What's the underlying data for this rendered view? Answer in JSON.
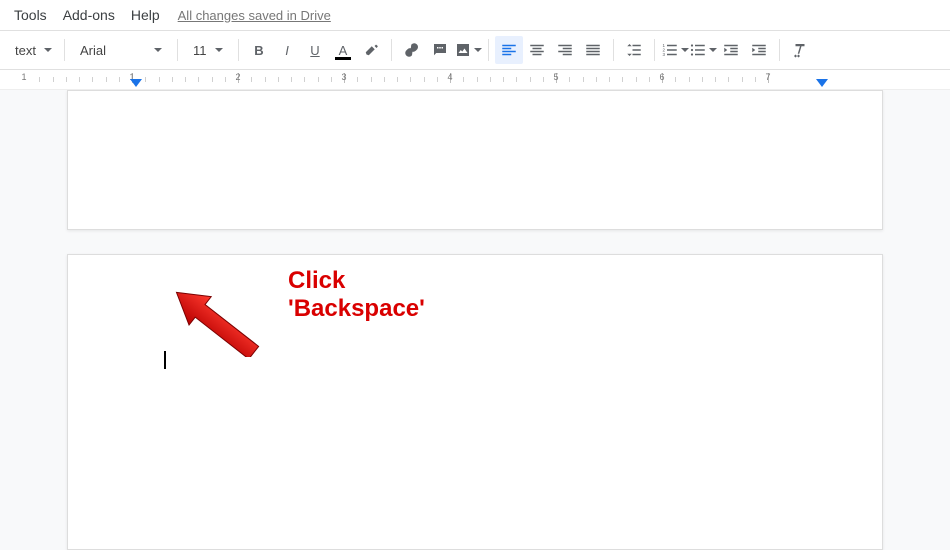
{
  "menu": {
    "tools": "Tools",
    "addons": "Add-ons",
    "help": "Help"
  },
  "save_status": "All changes saved in Drive",
  "toolbar": {
    "style_label": "text",
    "font_label": "Arial",
    "font_size": "11"
  },
  "ruler": {
    "marks": [
      "1",
      "1",
      "2",
      "3",
      "4",
      "5",
      "6",
      "7"
    ]
  },
  "colors": {
    "accent": "#1a73e8",
    "annotation": "#d90000"
  },
  "annotation": {
    "text": "Click 'Backspace'"
  },
  "cursor_text": ""
}
